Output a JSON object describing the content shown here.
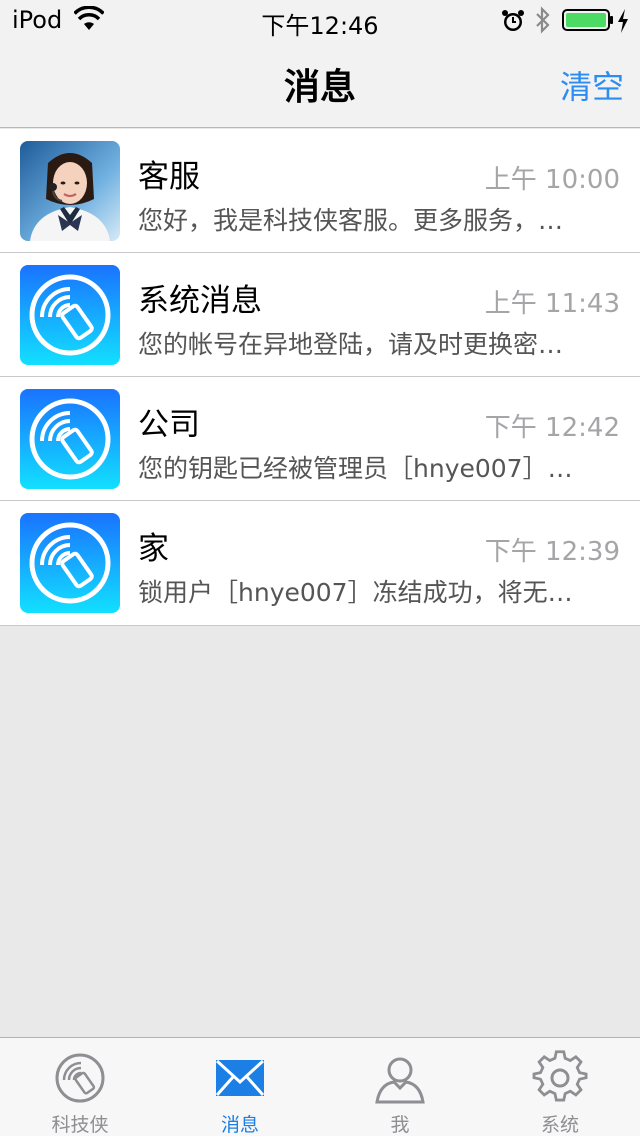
{
  "status_bar": {
    "carrier": "iPod",
    "time": "下午12:46",
    "battery_color": "#4cd964"
  },
  "nav": {
    "title": "消息",
    "action": "清空"
  },
  "colors": {
    "accent": "#2d8cf0",
    "app_icon_gradient_top": "#1a73ff",
    "app_icon_gradient_bottom": "#12e0ff"
  },
  "messages": [
    {
      "avatar": "customer-service-photo",
      "title": "客服",
      "time": "上午 10:00",
      "preview": "您好，我是科技侠客服。更多服务，…"
    },
    {
      "avatar": "app-logo-icon",
      "title": "系统消息",
      "time": "上午 11:43",
      "preview": "您的帐号在异地登陆，请及时更换密…"
    },
    {
      "avatar": "app-logo-icon",
      "title": "公司",
      "time": "下午 12:42",
      "preview": "您的钥匙已经被管理员［hnye007］…"
    },
    {
      "avatar": "app-logo-icon",
      "title": "家",
      "time": "下午 12:39",
      "preview": "锁用户［hnye007］冻结成功，将无…"
    }
  ],
  "tabs": [
    {
      "label": "科技侠",
      "icon": "phone-signal-icon",
      "active": false
    },
    {
      "label": "消息",
      "icon": "envelope-icon",
      "active": true
    },
    {
      "label": "我",
      "icon": "person-icon",
      "active": false
    },
    {
      "label": "系统",
      "icon": "gear-icon",
      "active": false
    }
  ]
}
